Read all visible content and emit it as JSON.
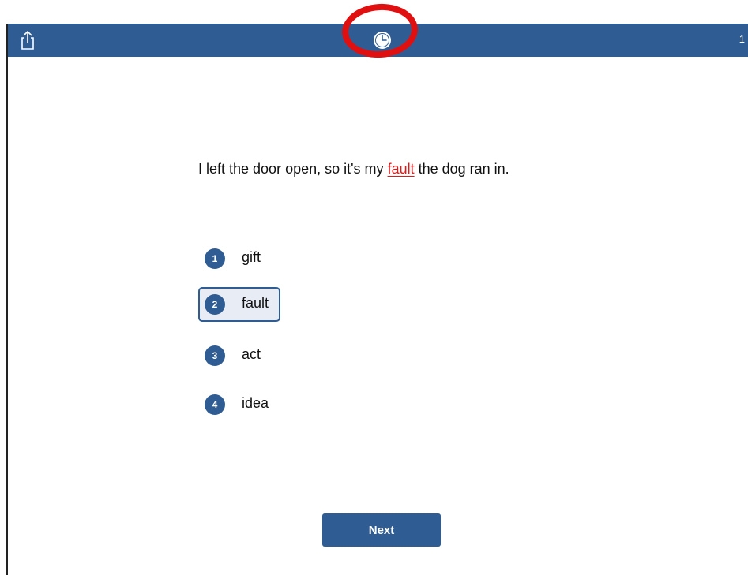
{
  "header": {
    "share_icon": "share-icon",
    "timer_icon": "clock-icon",
    "page_number": "1",
    "bar_color": "#2f5d93",
    "annotation_color": "#e01010"
  },
  "question": {
    "before": "I left the door open, so it's my ",
    "target": "fault",
    "after": " the dog ran in.",
    "target_color": "#e01a1a"
  },
  "options": [
    {
      "number": "1",
      "label": "gift",
      "selected": false
    },
    {
      "number": "2",
      "label": "fault",
      "selected": true
    },
    {
      "number": "3",
      "label": "act",
      "selected": false
    },
    {
      "number": "4",
      "label": "idea",
      "selected": false
    }
  ],
  "footer": {
    "next_label": "Next"
  }
}
